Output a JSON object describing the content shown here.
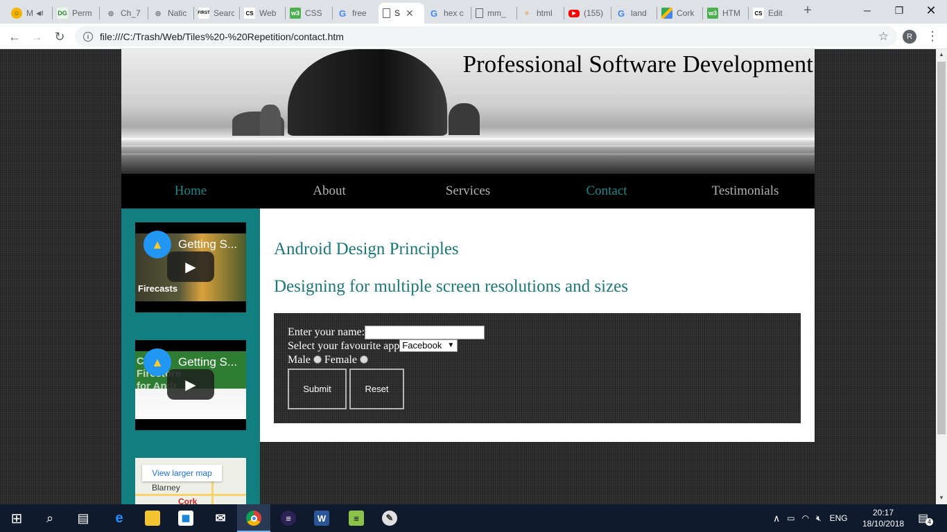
{
  "browser": {
    "tabs": [
      {
        "title": "M",
        "icon": "emoji-icon",
        "muted": true
      },
      {
        "title": "Perm",
        "icon": "dg-icon",
        "glyph": "DG"
      },
      {
        "title": "Ch_7",
        "icon": "wifi-icon"
      },
      {
        "title": "Natic",
        "icon": "wifi-icon"
      },
      {
        "title": "Searc",
        "icon": "first-icon",
        "glyph": "FIRST"
      },
      {
        "title": "Web",
        "icon": "cs-icon",
        "glyph": "CS"
      },
      {
        "title": "CSS",
        "icon": "w3-icon",
        "glyph": "w3"
      },
      {
        "title": "free",
        "icon": "google-icon",
        "glyph": "G"
      },
      {
        "title": "S",
        "icon": "page-icon",
        "active": true
      },
      {
        "title": "hex c",
        "icon": "google-icon",
        "glyph": "G"
      },
      {
        "title": "mm_",
        "icon": "page-icon"
      },
      {
        "title": "html",
        "icon": "stackoverflow-icon"
      },
      {
        "title": "(155)",
        "icon": "youtube-icon"
      },
      {
        "title": "land",
        "icon": "google-icon",
        "glyph": "G"
      },
      {
        "title": "Cork",
        "icon": "maps-icon"
      },
      {
        "title": "HTM",
        "icon": "w3-icon",
        "glyph": "w3"
      },
      {
        "title": "Edit",
        "icon": "cs-icon",
        "glyph": "CS"
      }
    ],
    "new_tab": "+",
    "url": "file:///C:/Trash/Web/Tiles%20-%20Repetition/contact.htm",
    "profile_initial": "R"
  },
  "site": {
    "title": "Professional Software Development",
    "nav": [
      {
        "label": "Home",
        "color": "teal"
      },
      {
        "label": "About",
        "color": "grey"
      },
      {
        "label": "Services",
        "color": "grey"
      },
      {
        "label": "Contact",
        "color": "teal"
      },
      {
        "label": "Testimonials",
        "color": "grey"
      }
    ],
    "sidebar": {
      "video1": {
        "title": "Getting S...",
        "caption": "Firecasts"
      },
      "video2": {
        "title": "Getting S...",
        "caption_lines": [
          "C",
          "Firestore",
          "for Andr"
        ]
      },
      "map": {
        "button": "View larger map",
        "place": "Blarney",
        "city": "Cork"
      }
    },
    "headings": [
      "Android Design Principles",
      "Designing for multiple screen resolutions and sizes"
    ],
    "form": {
      "name_label": "Enter your name:",
      "app_label": "Select your favourite app",
      "app_selected": "Facebook",
      "male_label": "Male",
      "female_label": "Female",
      "submit": "Submit",
      "reset": "Reset"
    }
  },
  "taskbar": {
    "time": "20:17",
    "date": "18/10/2018",
    "lang": "ENG",
    "notifications": "4"
  },
  "colors": {
    "teal": "#117e80",
    "link_teal": "#1a8a8a",
    "heading_teal": "#1a7878",
    "nav_grey": "#b3b3b3",
    "nav_bg": "#000000"
  }
}
